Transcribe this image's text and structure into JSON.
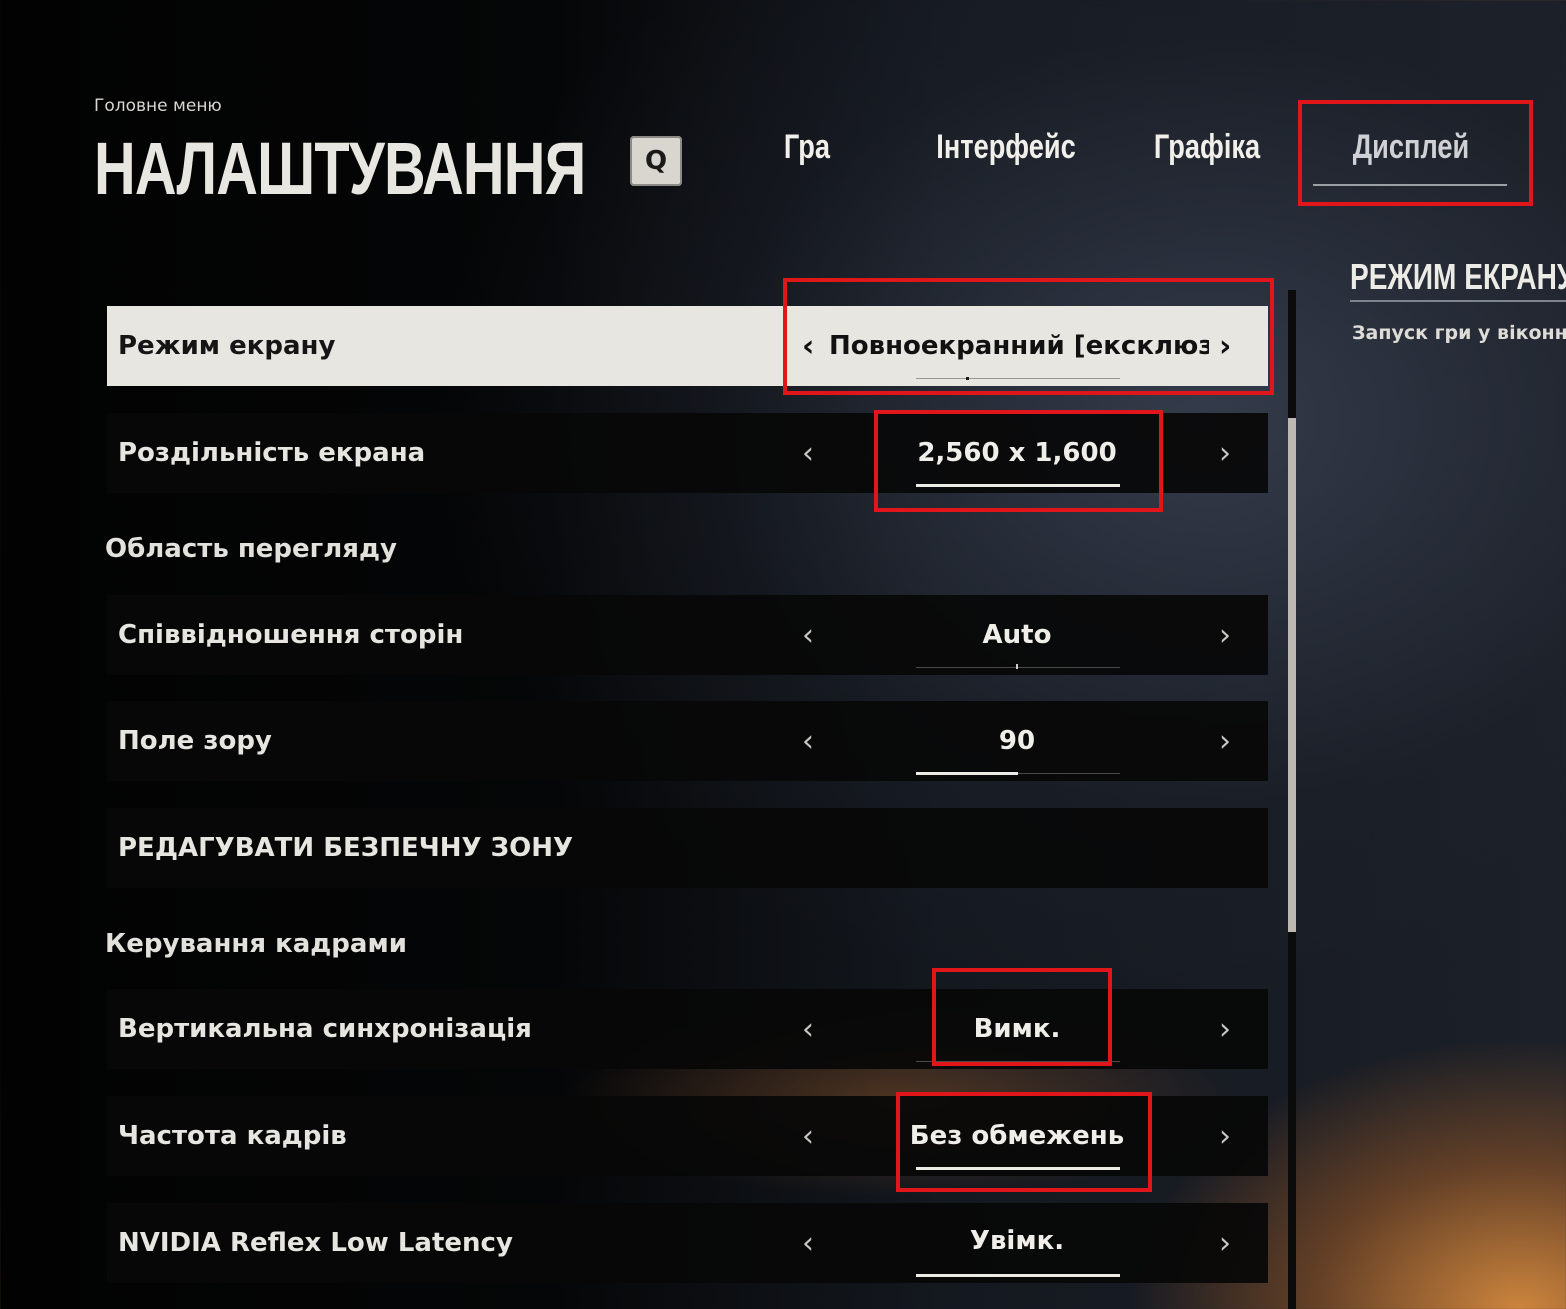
{
  "header": {
    "breadcrumb": "Головне меню",
    "title": "НАЛАШТУВАННЯ",
    "key_hint": "Q"
  },
  "tabs": [
    {
      "label": "Гра",
      "active": false
    },
    {
      "label": "Інтерфейс",
      "active": false
    },
    {
      "label": "Графіка",
      "active": false
    },
    {
      "label": "Дисплей",
      "active": true
    }
  ],
  "settings": {
    "screen_mode": {
      "label": "Режим екрану",
      "value": "Повноекранний [ексклюзив"
    },
    "resolution": {
      "label": "Роздільність екрана",
      "value": "2,560 x 1,600",
      "level": 1.0
    },
    "section_view": "Область перегляду",
    "aspect_ratio": {
      "label": "Співвідношення сторін",
      "value": "Auto"
    },
    "fov": {
      "label": "Поле зору",
      "value": "90",
      "level": 0.5
    },
    "safe_zone": {
      "label": "РЕДАГУВАТИ БЕЗПЕЧНУ ЗОНУ"
    },
    "section_frames": "Керування кадрами",
    "vsync": {
      "label": "Вертикальна синхронізація",
      "value": "Вимк."
    },
    "frame_rate": {
      "label": "Частота кадрів",
      "value": "Без обмежень",
      "level": 1.0
    },
    "nvidia_reflex": {
      "label": "NVIDIA Reflex Low Latency",
      "value": "Увімк.",
      "level": 1.0
    }
  },
  "side_panel": {
    "title": "РЕЖИМ ЕКРАНУ",
    "description": "Запуск гри у віконному"
  },
  "colors": {
    "highlight": "#e0161a",
    "selected_row": "#e8e6e1",
    "row_bg": "#080808"
  }
}
